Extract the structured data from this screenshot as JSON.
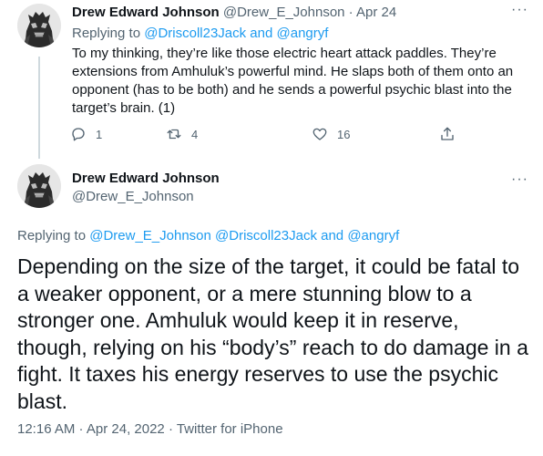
{
  "tweet1": {
    "name": "Drew Edward Johnson",
    "handle": "@Drew_E_Johnson",
    "dot": " · ",
    "date": "Apr 24",
    "replying_prefix": "Replying to ",
    "replying_handle1": "@Driscoll23Jack",
    "replying_and": " and ",
    "replying_handle2": "@angryf",
    "text": "To my thinking, they’re like those electric heart attack paddles. They’re extensions from Amhuluk’s powerful mind. He slaps both of them onto an opponent (has to be both) and he sends a powerful psychic blast into the target’s brain. (1)",
    "more": "···",
    "replies": "1",
    "retweets": "4",
    "likes": "16"
  },
  "tweet2": {
    "name": "Drew Edward Johnson",
    "handle": "@Drew_E_Johnson",
    "more": "···",
    "replying_prefix": "Replying to ",
    "replying_handle1": "@Drew_E_Johnson",
    "replying_handle2": "@Driscoll23Jack",
    "replying_and": " and ",
    "replying_handle3": "@angryf",
    "text": "Depending on the size of the target, it could be fatal to a weaker opponent, or a mere stunning blow to a stronger one. Amhuluk would keep it in reserve, though, relying on his “body’s” reach to do damage in a fight. It taxes his energy reserves to use the psychic blast.",
    "timestamp": "12:16 AM · Apr 24, 2022 · Twitter for iPhone"
  },
  "icons": {
    "reply": "reply-icon",
    "retweet": "retweet-icon",
    "like": "heart-icon",
    "share": "share-icon",
    "more": "more-icon"
  },
  "colors": {
    "link": "#1d9bf0",
    "secondary_text": "#536471",
    "primary_text": "#0f1419",
    "thread_line": "#cfd9de"
  }
}
